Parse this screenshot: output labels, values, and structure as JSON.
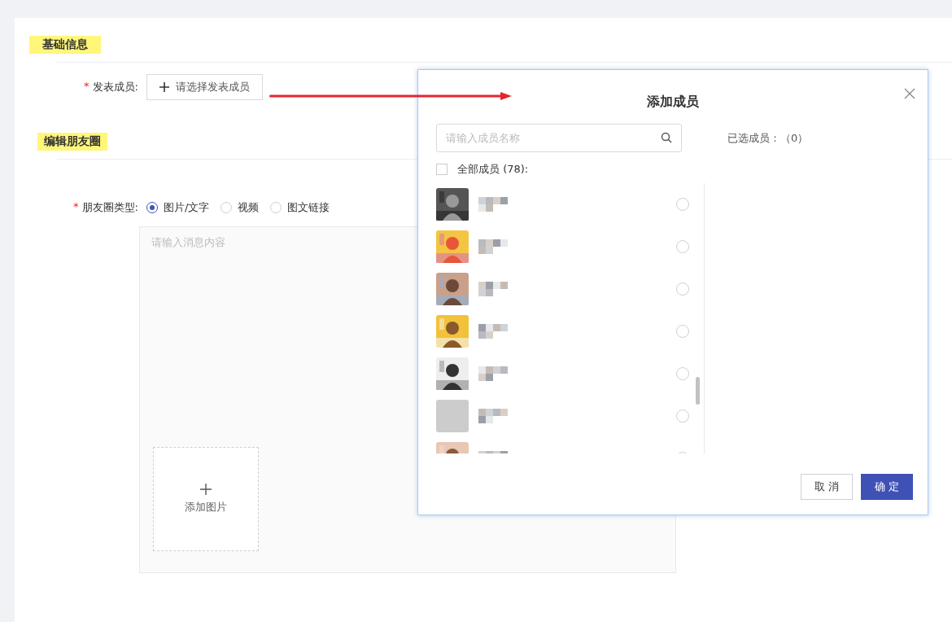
{
  "sections": [
    {
      "title": "基础信息"
    },
    {
      "title": "编辑朋友圈"
    }
  ],
  "publisher": {
    "required_mark": "*",
    "label": "发表成员:",
    "button": "请选择发表成员"
  },
  "post_type": {
    "required_mark": "*",
    "label": "朋友圈类型:",
    "options": [
      {
        "label": "图片/文字",
        "selected": true
      },
      {
        "label": "视频",
        "selected": false
      },
      {
        "label": "图文链接",
        "selected": false
      }
    ]
  },
  "message": {
    "placeholder": "请输入消息内容",
    "add_image": "添加图片"
  },
  "dialog": {
    "title": "添加成员",
    "search": {
      "placeholder": "请输入成员名称"
    },
    "select_all": {
      "label": "全部成员 (78):",
      "checked": false
    },
    "members": [
      {
        "kind": "picture",
        "selected": false
      },
      {
        "kind": "picture",
        "selected": false
      },
      {
        "kind": "picture",
        "selected": false
      },
      {
        "kind": "picture",
        "selected": false
      },
      {
        "kind": "picture",
        "selected": false
      },
      {
        "kind": "blank",
        "selected": false
      },
      {
        "kind": "picture",
        "selected": false
      }
    ],
    "selected_label": "已选成员：（0）",
    "buttons": [
      "取 消",
      "确 定"
    ]
  }
}
